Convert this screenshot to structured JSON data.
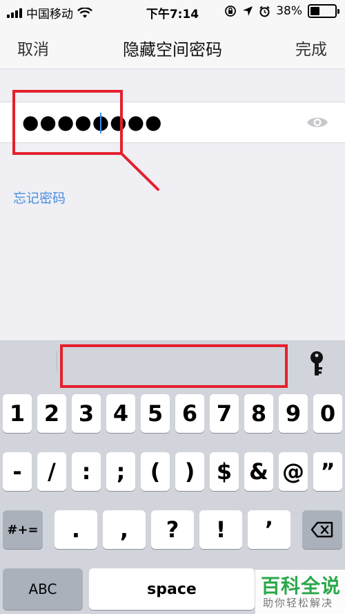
{
  "status_bar": {
    "carrier": "中国移动",
    "time": "下午7:14",
    "battery": "38%",
    "battery_level": 0.38
  },
  "nav": {
    "cancel": "取消",
    "title": "隐藏空间密码",
    "done": "完成"
  },
  "password": {
    "masked_value": "●●●●●●●●"
  },
  "forgot_link": "忘记密码",
  "keyboard": {
    "row1": [
      "1",
      "2",
      "3",
      "4",
      "5",
      "6",
      "7",
      "8",
      "9",
      "0"
    ],
    "row2": [
      "-",
      "/",
      ":",
      ";",
      "(",
      ")",
      "$",
      "&",
      "@",
      "”"
    ],
    "row3_mode": "#+=",
    "row3": [
      ".",
      ",",
      "?",
      "!",
      "’"
    ],
    "abc": "ABC",
    "space": "space"
  },
  "watermark": {
    "title": "百科全说",
    "subtitle": "助你轻松解决"
  },
  "colors": {
    "annotation": "#e5202e",
    "link": "#4a8ee0",
    "caret": "#3c8ff5",
    "watermark": "#2aa84a"
  },
  "icons": [
    "wifi-icon",
    "lock-rotation-icon",
    "location-icon",
    "alarm-icon",
    "eye-icon",
    "key-icon",
    "backspace-icon"
  ]
}
